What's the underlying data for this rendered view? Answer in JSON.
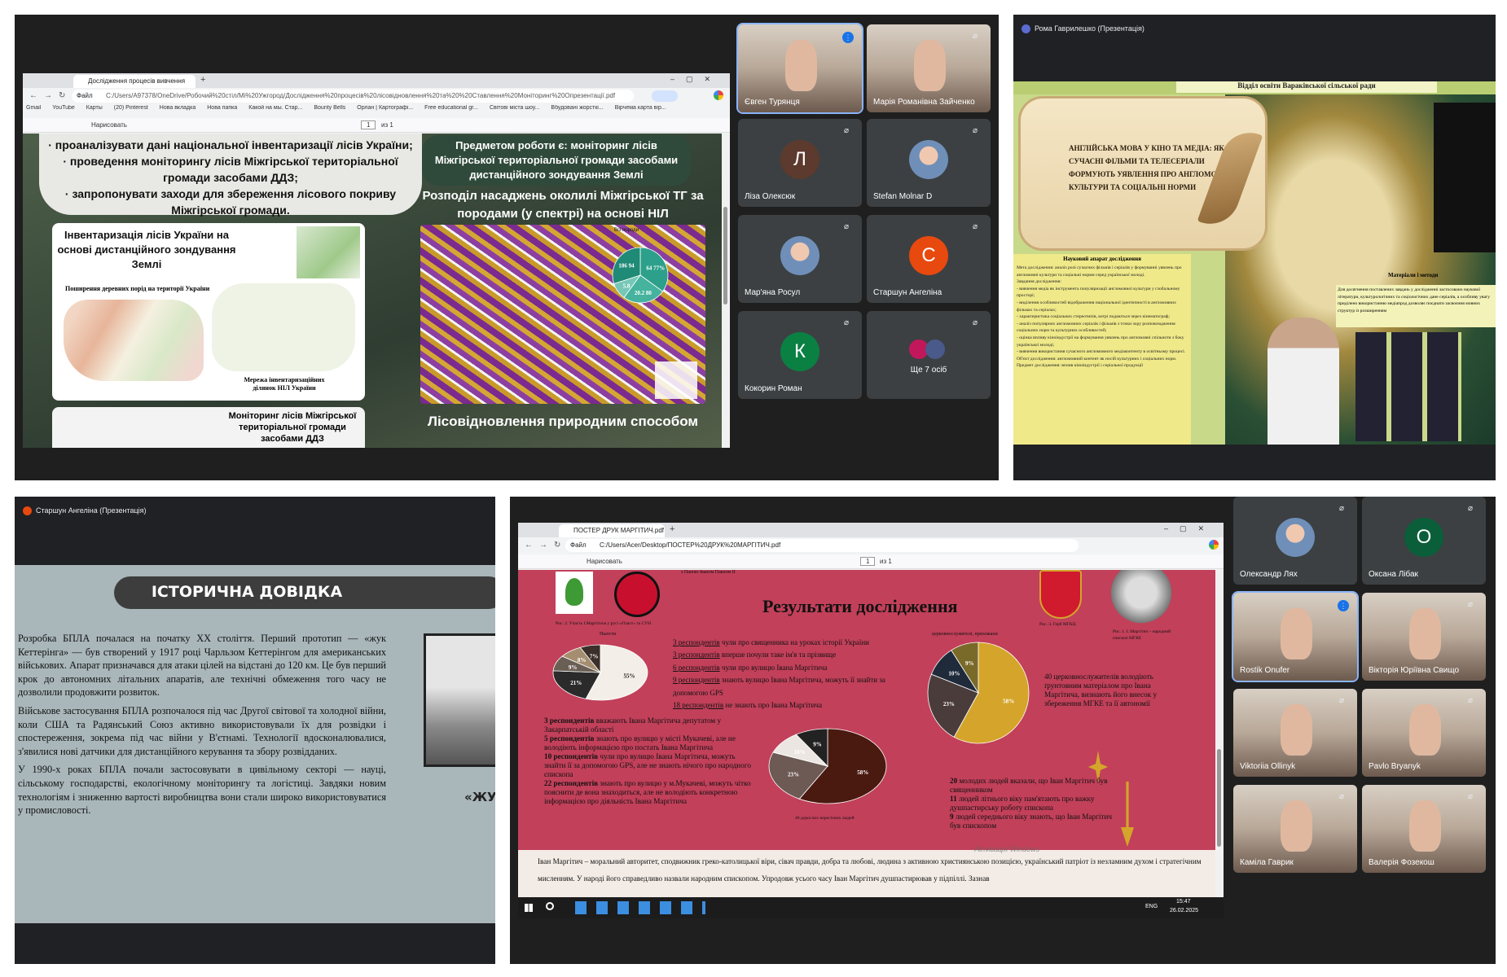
{
  "panel1": {
    "browser": {
      "tab_title": "Дослідження процесів вивчення",
      "address": "C:/Users/A97378/OneDrive/Робочий%20стіл/Мі%20Ужгород/Дослідження%20процесів%20лісовідновлення%20та%20%20Ставлення%20Моніторинг%20Опрезентації.pdf",
      "file_label": "Файл",
      "bookmarks": [
        "Gmail",
        "YouTube",
        "Карты",
        "(20) Pinterest",
        "Нова вкладка",
        "Нова папка",
        "Какой на мы. Стар...",
        "Bounty Bells",
        "Орлан | Картографі...",
        "Free educational gr...",
        "Світові міста шоу...",
        "Вбудовані жорсткі...",
        "Вірчема карта вір..."
      ],
      "pdf_toolbar": {
        "draw": "Нарисовать",
        "page": "1",
        "of": "из 1"
      }
    },
    "slide": {
      "bullets": [
        "· проаналізувати дані національної інвентаризації лісів України;",
        "· проведення моніторингу лісів Міжгірської територіальної громади засобами ДДЗ;",
        "· запропонувати заходи для збереження лісового покриву Міжгірської громади."
      ],
      "subject_box": "Предметом роботи є: моніторинг лісів Міжгірської територіальної громади засобами дистанційного зондування Землі",
      "distribution_title": "Розподіл насаджень околилі Міжгірської ТГ за породами (у спектрі) на основі НІЛ",
      "inventory_title": "Інвентаризація лісів України на основі дистанційного зондування Землі",
      "map1_caption": "Поширення деревних порід на території України",
      "map2_caption": "Мережа інвентаризаційних ділянок НІЛ України",
      "monitoring_title": "Моніторинг лісів Міжгірської територіальної громади засобами ДДЗ",
      "regen_title": "Лісовідновлення природним способом",
      "pie_title": "Всі породи",
      "pie_labels": [
        "64 77%",
        "20.2 80",
        "5.8",
        "186 94"
      ]
    }
  },
  "video_tiles_top": [
    {
      "name": "Євген Турянця",
      "type": "video",
      "speaking": true
    },
    {
      "name": "Марія Романівна Зайченко",
      "type": "video"
    },
    {
      "name": "Ліза Олексюк",
      "type": "letter",
      "letter": "Л",
      "color": "#5d3a2e"
    },
    {
      "name": "Stefan Molnar D",
      "type": "photo"
    },
    {
      "name": "Мар'яна Росул",
      "type": "photo"
    },
    {
      "name": "Старшун Ангеліна",
      "type": "letter",
      "letter": "С",
      "color": "#e8490f"
    },
    {
      "name": "Кокорин Роман",
      "type": "letter",
      "letter": "К",
      "color": "#0b8043"
    },
    {
      "name": "Ще 7 осіб",
      "type": "more"
    }
  ],
  "panel2": {
    "presenter": "Рома Гаврилешко (Презентація)",
    "header_strip": "Відділ освіти Вараківської сільської ради",
    "scroll_title": "АНГЛІЙСЬКА МОВА У КІНО ТА МЕДІА: ЯК СУЧАСНІ ФІЛЬМИ ТА ТЕЛЕСЕРІАЛИ ФОРМУЮТЬ УЯВЛЕННЯ ПРО АНГЛОМОВНІ КУЛЬТУРИ ТА СОЦІАЛЬНІ НОРМИ",
    "apparatus_title": "Науковий апарат дослідження",
    "materials_title": "Матеріали і методи",
    "apparatus_lines": [
      "Мета дослідження: аналіз ролі сучасних фільмів і серіалів у формуванні уявлень про англомовні культури та соціальні норми серед української молоді.",
      "Завдання дослідження:",
      "- вивчення медіа як інструмента популяризації англомовної культури у глобальному просторі;",
      "- виділення особливостей відображення національної ідентичності в англомовних фільмах та серіалах;",
      "- характеристика соціальних стереотипів, котрі подаються через кінематограф;",
      "- аналіз популярних англомовних серіалів і фільмів з точки зору розповсюдження соціальних норм та культурних особливостей;",
      "- оцінка впливу кіноіндустрії на формування уявлень про англомовні спільноти з боку української молоді;",
      "- вивчення використання сучасного англомовного медіаконтенту в освітньому процесі.",
      "Об'єкт дослідження: англомовний контент як носій культурних і соціальних норм.",
      "Предмет дослідження: вплив кіноіндустрії і серіальної продукції"
    ],
    "materials_text": "Для досягнення поставлених завдань у дослідженні застосовано наукової літератури, культурологічних та соціологічних дане серіалів, а особливу увагу приділено використанню медіапрод дозволяє поєднати засвоєння мовних структур із розширенням"
  },
  "panel3": {
    "presenter": "Старшун Ангеліна (Презентація)",
    "title": "ІСТОРИЧНА ДОВІДКА",
    "paragraphs": [
      "Розробка БПЛА почалася на початку ХХ століття. Перший прототип — «жук Кеттерінга» — був створений у 1917 році Чарльзом Кеттерінгом для американських військових. Апарат призначався для атаки цілей на відстані до 120 км. Це був перший крок до автономних літальних апаратів, але технічні обмеження того часу не дозволили продовжити розвиток.",
      "Військове застосування БПЛА розпочалося під час Другої світової та холодної війни, коли США та Радянський Союз активно використовували їх для розвідки і спостереження, зокрема під час війни у В'єтнамі. Технології вдосконалювалися, з'явилися нові датчики для дистанційного керування та збору розвідданих.",
      "У 1990-х роках БПЛА почали застосовувати в цивільному секторі — науці, сільському господарстві, екологічному моніторингу та логістиці. Завдяки новим технологіям і зниженню вартості виробництва вони стали широко використовуватися у промисловості."
    ],
    "photo_caption": "«ЖУК"
  },
  "panel4": {
    "browser": {
      "tab_title": "ПОСТЕР ДРУК МАРГІТИЧ.pdf",
      "file_label": "Файл",
      "address": "C:/Users/Acer/Desktop/ПОСТЕР%20ДРУК%20МАРГІТИЧ.pdf",
      "pdf_toolbar": {
        "draw": "Нарисовать",
        "page": "1",
        "of": "из 1"
      }
    },
    "poster": {
      "title": "Результати дослідження",
      "top_caption": "з Папою Іваном Павлом ІІ",
      "fig2": "Рис. 2. Участь І.Маргітича у русі «Пласт» та СУН",
      "fig3": "Рис. 3. Герб МГКЦ",
      "fig1": "Рис. 1. І. Маргітич – народний єпископ МГКЕ",
      "pie1_title": "Ньюсти",
      "pie1_labels": [
        "7%",
        "8%",
        "9%",
        "21%",
        "55%"
      ],
      "pie1_legend": [
        {
          "strong": "3 респондентів",
          "text": " чули про священника на уроках історії України"
        },
        {
          "strong": "3 респондентів",
          "text": " вперше почули таке ім'я та прізвище"
        },
        {
          "strong": "6 респондентів",
          "text": " чули про вулицю Івана Маргітича"
        },
        {
          "strong": "9 респондентів",
          "text": " знають вулицю Івана Маргітича, можуть її знайти за допомогою GPS"
        },
        {
          "strong": "18 респондентів",
          "text": " не знають про Івана Маргітича"
        }
      ],
      "middle_text": [
        {
          "strong": "3 респондентів",
          "text": " вважають Івана Маргітича депутатом у Закарпатській області"
        },
        {
          "strong": "5 респондентів",
          "text": " знають про вулицю у місті Мукачеві, але не володіють інформацією про постать Івана Маргітича"
        },
        {
          "strong": "10 респондентів",
          "text": " чули про вулицю Івана Маргітича, можуть знайти її за допомогою GPS, але не знають нічого про народного єпископа"
        },
        {
          "strong": "22 респондентів",
          "text": " знають про вулицю у м.Мукачеві, можуть чітко пояснити де вона знаходиться, але не володіють конкретною інформацією про діяльність Івана Маргітича"
        }
      ],
      "pie2_labels": [
        "9%",
        "10%",
        "23%",
        "58%"
      ],
      "pie2_caption": "40 дорослих пересічних людей",
      "pie3_title": "церковнослужителі, прихожани",
      "pie3_labels": [
        "9%",
        "10%",
        "23%",
        "58%"
      ],
      "pie3_text": "40 церковнослужителів володіють ґрунтовним матеріалом про Івана Маргітича, визнають його внесок у збереження МГКЕ та її автономії",
      "right_text": [
        {
          "strong": "20",
          "text": " молодих людей вказали, що Іван Маргітич був священником"
        },
        {
          "strong": "11",
          "text": " людей літнього віку пам'ятають про важку душпастирську роботу єпископа"
        },
        {
          "strong": "9",
          "text": " людей середнього віку знають, що Іван Маргітич був єпископом"
        }
      ],
      "bottom_text": "Іван Маргітич – моральний авторитет, сподвижник греко-католицької віри, сівач правди, добра та любові, людина з активною християнською позицією, український патріот із незламним духом і стратегічним мисленням. У народі його справедливо назвали народним єпископом. Упродовж усього часу Іван Маргітич душпастирював у підпіллі. Зазнав",
      "watermark": "Активація Windows"
    },
    "taskbar": {
      "lang": "ENG",
      "time": "15:47",
      "date": "26.02.2025"
    }
  },
  "video_tiles_bottom": [
    {
      "name": "Олександр Лях",
      "type": "photo"
    },
    {
      "name": "Оксана Лібак",
      "type": "letter",
      "letter": "О",
      "color": "#0b5e3a"
    },
    {
      "name": "Rostik Onufer",
      "type": "video",
      "speaking": true
    },
    {
      "name": "Вікторія Юріївна Свищо",
      "type": "video"
    },
    {
      "name": "Viktoriia Ollinyk",
      "type": "video"
    },
    {
      "name": "Pavlo Bryanyk",
      "type": "video"
    },
    {
      "name": "Каміла Гаврик",
      "type": "video"
    },
    {
      "name": "Валерія Фозекош",
      "type": "video"
    }
  ]
}
